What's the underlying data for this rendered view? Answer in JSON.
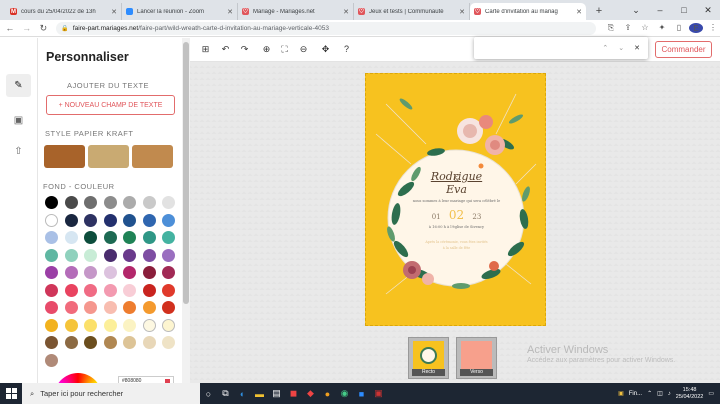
{
  "browser": {
    "tabs": [
      {
        "label": "cours du 25/04/2022 de 13h",
        "fav_color": "#d93025",
        "fav_char": "M",
        "active": false
      },
      {
        "label": "Lancer la réunion - Zoom",
        "fav_color": "#2d8cff",
        "fav_char": "",
        "active": false
      },
      {
        "label": "Mariage - Mariages.net",
        "fav_color": "#e0555a",
        "fav_char": "♡",
        "active": false
      },
      {
        "label": "Jeux et tests | Communauté",
        "fav_color": "#e0555a",
        "fav_char": "♡",
        "active": false
      },
      {
        "label": "Carte d'invitation au mariag",
        "fav_color": "#e0555a",
        "fav_char": "♡",
        "active": true
      }
    ],
    "url_host": "faire-part.mariages.net",
    "url_path": "/faire-part/wild-wreath-carte-d-invitation-au-mariage-verticale-4053",
    "profile_initial": "E"
  },
  "sidebar": {
    "title": "Personnaliser",
    "add_text_label": "AJOUTER DU TEXTE",
    "new_field_button": "+ NOUVEAU CHAMP DE TEXTE",
    "kraft_label": "STYLE PAPIER KRAFT",
    "kraft_colors": [
      "#a8632a",
      "#c9aa72",
      "#c18a4e"
    ],
    "background_label": "FOND - COULEUR",
    "swatches": [
      "#000000",
      "#4a4a4a",
      "#6e6e6e",
      "#8c8c8c",
      "#ababab",
      "#c9c9c9",
      "#e2e2e2",
      "#ffffff",
      "#1a2740",
      "#2d3262",
      "#23306e",
      "#20528f",
      "#2f66b0",
      "#4d8fd8",
      "#a9c0e6",
      "#d6e6f2",
      "#0d4d3c",
      "#1d6a53",
      "#1f8356",
      "#2f9786",
      "#44b3a1",
      "#5fb7a2",
      "#8fd1bd",
      "#c8ecd6",
      "#4a2c6e",
      "#6a3a8c",
      "#7e4ea3",
      "#9a6fc0",
      "#9b3fa6",
      "#b46cb9",
      "#c597c8",
      "#dcc2de",
      "#b3276b",
      "#8a1e3b",
      "#a12a55",
      "#d0365a",
      "#e94360",
      "#f06b84",
      "#f39ab0",
      "#f8cdd6",
      "#c9241f",
      "#e03a2b",
      "#e84b6a",
      "#f16b7c",
      "#f5978e",
      "#f8bdb0",
      "#ee7d2f",
      "#f49a2e",
      "#d1301e",
      "#f2b21e",
      "#f5c43a",
      "#fbe06a",
      "#fcef9a",
      "#fbf3c3",
      "#fdf8e2",
      "#fdf5d0",
      "#7b5532",
      "#8c6a43",
      "#6b4e1e",
      "#b08752",
      "#ddc497",
      "#e8d7b8",
      "#efe3c6",
      "#b08a78"
    ],
    "hex_value": "#808080"
  },
  "toolbar": {
    "find_up": "⌃",
    "find_down": "⌄",
    "find_close": "✕",
    "order_button": "Commander"
  },
  "card": {
    "name1": "Rodrigue",
    "amp": "&",
    "name2": "Eva",
    "invite_line": "nous sommes à leur mariage qui sera célébré le",
    "day": "01",
    "month": "02",
    "year": "23",
    "where_line": "à 16:00 h à l'église de Sivency",
    "reply_line": "Après la cérémonie, vous êtes invités",
    "reply_line2": "à la salle de fête"
  },
  "thumbnails": [
    {
      "label": "Recto",
      "active": true
    },
    {
      "label": "Verso",
      "active": false
    }
  ],
  "watermark": {
    "title": "Activer Windows",
    "subtitle": "Accédez aux paramètres pour activer Windows."
  },
  "taskbar": {
    "search_placeholder": "Taper ici pour rechercher",
    "app_label": "Fin...",
    "time": "15:48",
    "date": "25/04/2022"
  }
}
